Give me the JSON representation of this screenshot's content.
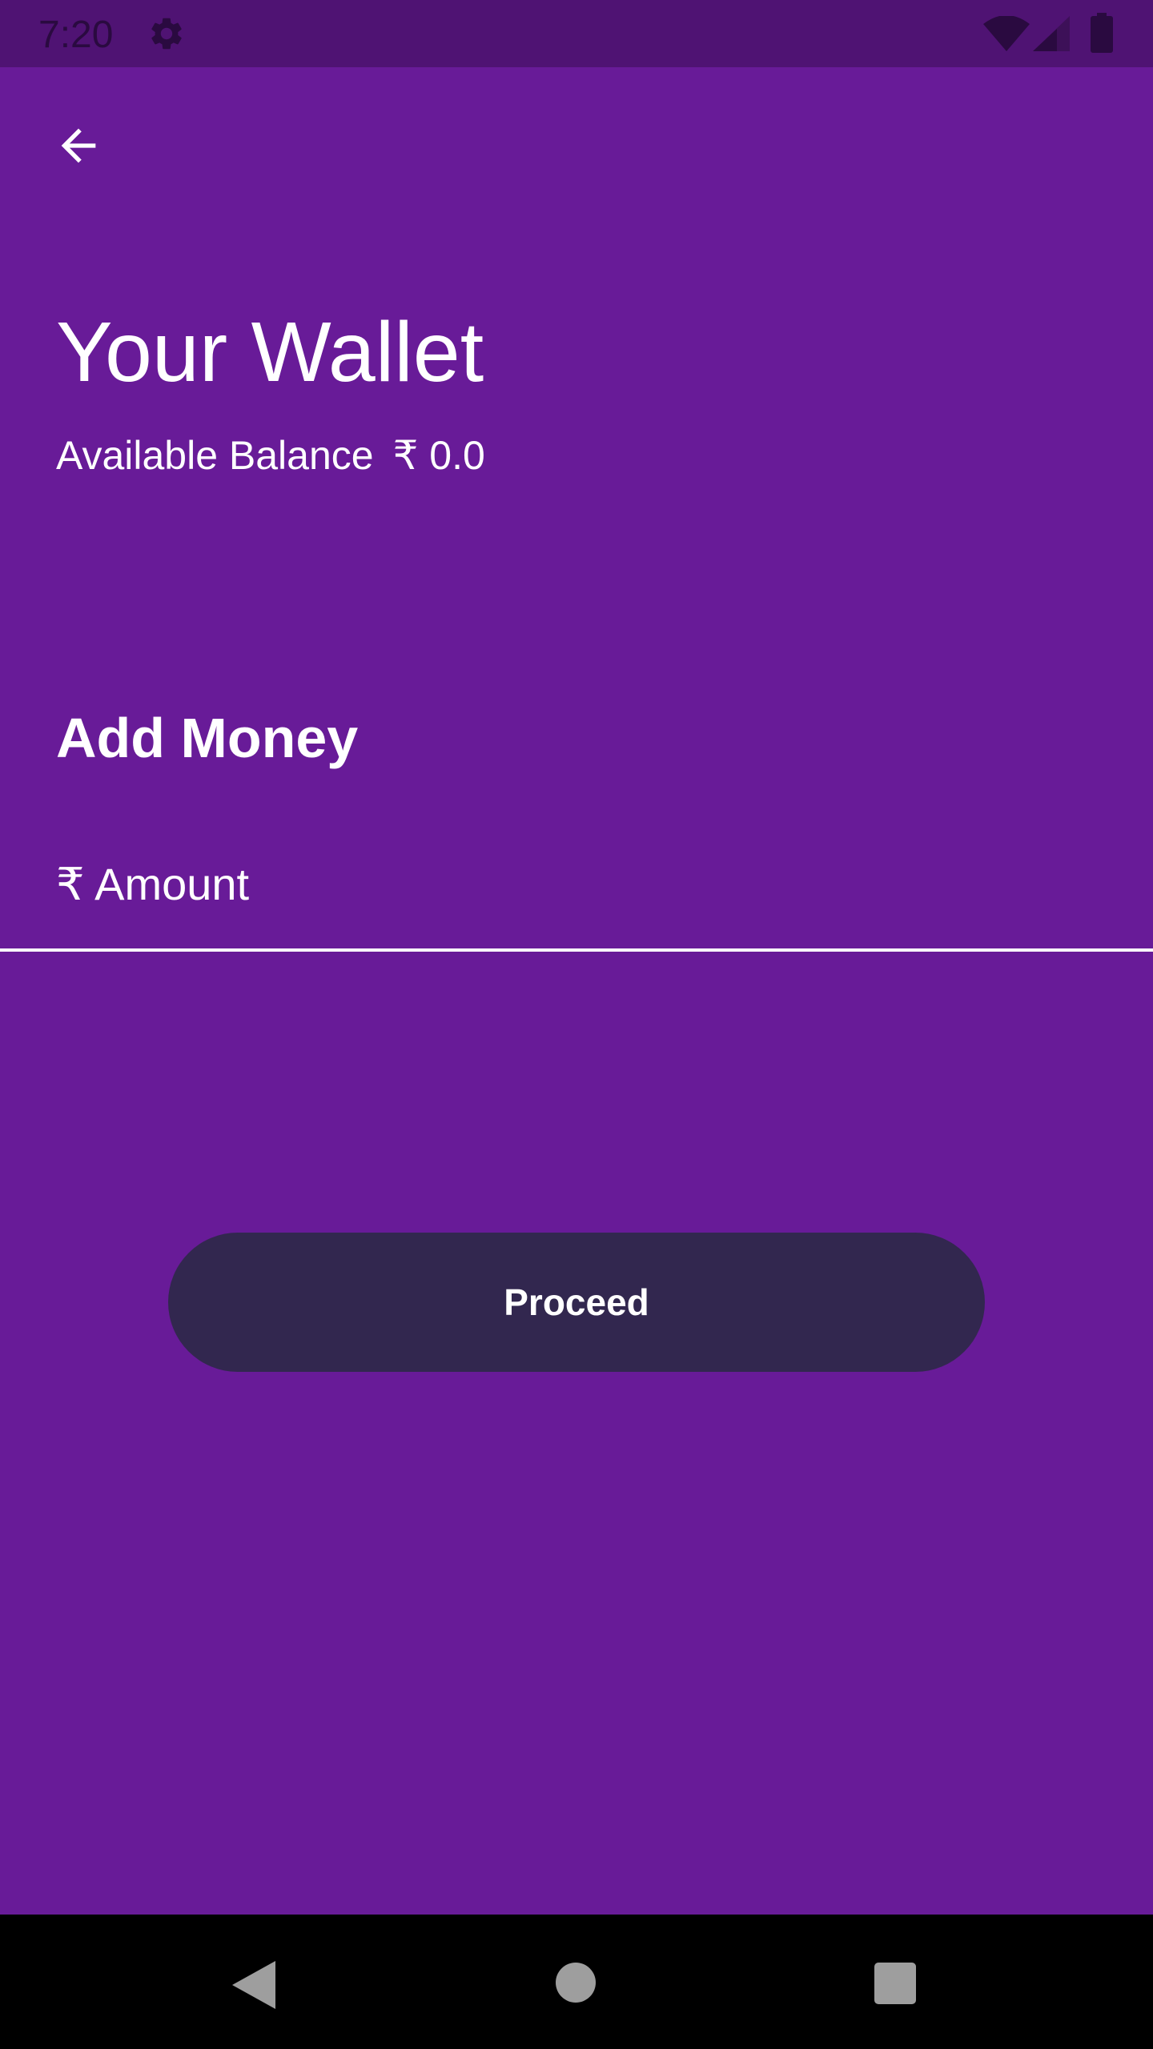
{
  "status_bar": {
    "time": "7:20",
    "icons": [
      "gear-icon",
      "wifi-icon",
      "signal-icon",
      "battery-icon"
    ]
  },
  "header": {
    "back_icon": "arrow-back-icon"
  },
  "wallet": {
    "title": "Your Wallet",
    "balance_label": "Available Balance",
    "balance_value": "₹ 0.0"
  },
  "add_money": {
    "title": "Add Money",
    "amount_placeholder": "₹ Amount",
    "amount_value": ""
  },
  "actions": {
    "proceed_label": "Proceed"
  },
  "nav_bar": {
    "icons": [
      "nav-back-icon",
      "nav-home-icon",
      "nav-recents-icon"
    ]
  },
  "colors": {
    "background": "#681b98",
    "status_bar": "#4f1373",
    "button": "#32274f",
    "text": "#ffffff",
    "nav_bar": "#000000",
    "nav_icon": "#9e9e9e"
  }
}
